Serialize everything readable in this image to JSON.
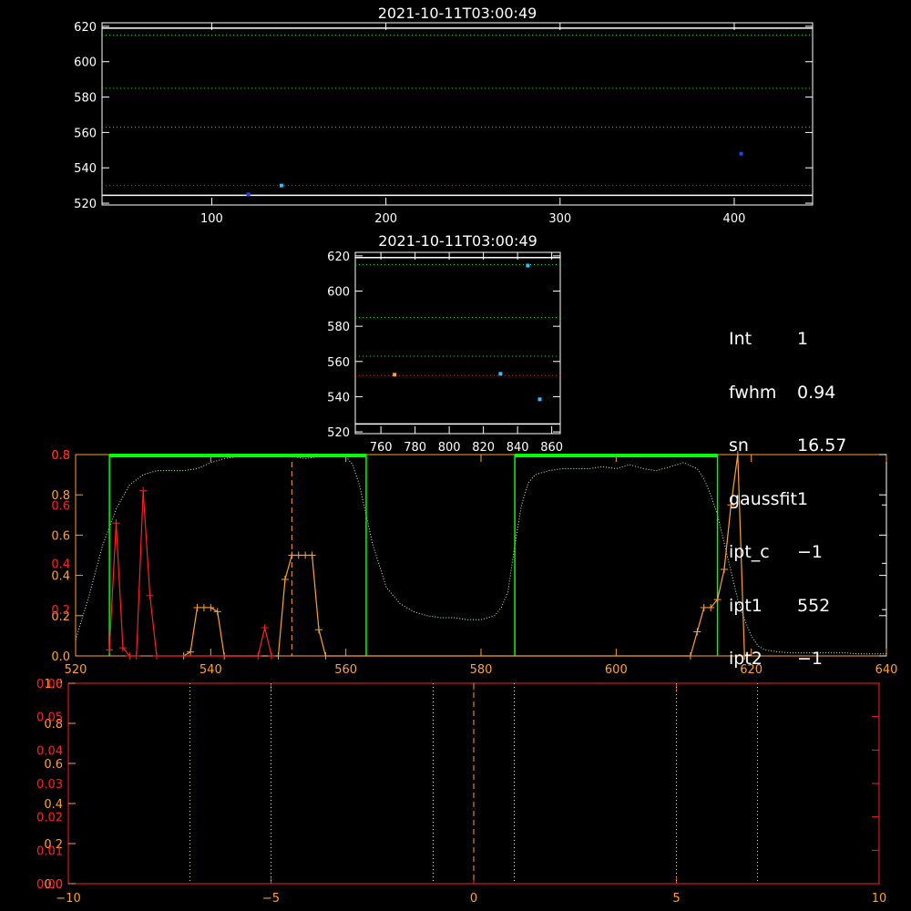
{
  "colors": {
    "background": "#000000",
    "axis": "#ffffff",
    "axis_red": "#ff2020",
    "accent_orange": "#ffa030",
    "green_line": "#00ff00",
    "dotted_green": "#30d030",
    "dotted_red": "#d03030",
    "dotted_yellow": "#e0e080",
    "dotted_light": "#c8ffc8",
    "red_series": "#ff2020",
    "orange_series": "#ffa030",
    "cyan_point": "#30c0ff",
    "blue_point": "#2040ff"
  },
  "info": [
    {
      "key": "Int",
      "value": "1"
    },
    {
      "key": "fwhm",
      "value": "0.94"
    },
    {
      "key": "sn",
      "value": "16.57"
    },
    {
      "key": "gaussfit",
      "value": "1"
    },
    {
      "key": "ipt_c",
      "value": "−1"
    },
    {
      "key": "ipt1",
      "value": "552"
    },
    {
      "key": "ipt2",
      "value": "−1"
    }
  ],
  "chart_data": [
    {
      "type": "scatter",
      "title": "2021-10-11T03:00:49",
      "xlim": [
        37,
        445
      ],
      "ylim": [
        519,
        622
      ],
      "xticks": [
        100,
        200,
        300,
        400
      ],
      "yticks": [
        520,
        540,
        560,
        580,
        600,
        620
      ],
      "hlines_green": [
        615,
        585,
        563
      ],
      "hlines_red": [
        530
      ],
      "hlines_white": [
        619,
        524.5
      ],
      "points": [
        {
          "x": 140,
          "y": 530,
          "color": "cyan"
        },
        {
          "x": 404,
          "y": 548,
          "color": "blue"
        },
        {
          "x": 121,
          "y": 525,
          "color": "blue"
        }
      ]
    },
    {
      "type": "scatter",
      "title": "2021-10-11T03:00:49",
      "xlim": [
        745,
        865
      ],
      "ylim": [
        519,
        622
      ],
      "xticks": [
        760,
        780,
        800,
        820,
        840,
        860
      ],
      "yticks": [
        520,
        540,
        560,
        580,
        600,
        620
      ],
      "hlines_green": [
        615,
        585,
        563
      ],
      "hlines_red": [
        552
      ],
      "hlines_white": [
        619,
        524.5
      ],
      "points": [
        {
          "x": 846,
          "y": 614.5,
          "color": "cyan"
        },
        {
          "x": 830,
          "y": 553,
          "color": "cyan"
        },
        {
          "x": 768,
          "y": 552.5,
          "color": "orange"
        },
        {
          "x": 853,
          "y": 538.5,
          "color": "cyan"
        }
      ]
    },
    {
      "type": "line",
      "xlim": [
        520,
        640
      ],
      "ylim": [
        0,
        1
      ],
      "xticks": [
        520,
        540,
        560,
        580,
        600,
        620,
        640
      ],
      "yticks_orange": [
        0.0,
        0.2,
        0.4,
        0.6,
        0.8
      ],
      "yticks_red": [
        0.2,
        0.4,
        0.6,
        0.8
      ],
      "ytick_labels_orange": [
        "0.0",
        "0.2",
        "0.4",
        "0.6",
        "0.8",
        "0.8"
      ],
      "ytick_labels_red": [
        "0.2",
        "0.4",
        "0.6",
        "0.8"
      ],
      "green_boxes": [
        [
          525,
          563
        ],
        [
          585,
          615
        ]
      ],
      "vline_dashed": 552,
      "red_series": {
        "x": [
          525,
          526,
          527,
          528,
          529,
          530,
          531,
          532,
          547,
          548,
          549
        ],
        "y": [
          0.03,
          0.66,
          0.04,
          0.0,
          0.0,
          0.82,
          0.3,
          0.0,
          0.0,
          0.14,
          0.0
        ]
      },
      "orange_series": {
        "x": [
          536,
          537,
          538,
          539,
          540,
          541,
          542,
          550,
          551,
          552,
          553,
          554,
          555,
          556,
          557,
          611,
          612,
          613,
          614,
          615,
          616,
          617,
          618,
          619
        ],
        "y": [
          0.0,
          0.02,
          0.24,
          0.24,
          0.24,
          0.22,
          0.0,
          0.0,
          0.38,
          0.5,
          0.5,
          0.5,
          0.5,
          0.13,
          0.0,
          0.0,
          0.12,
          0.24,
          0.24,
          0.28,
          0.43,
          0.75,
          1.0,
          0.0
        ]
      },
      "dotted_profile": {
        "x": [
          520,
          522,
          524,
          526,
          528,
          530,
          532,
          534,
          536,
          538,
          540,
          542,
          544,
          546,
          548,
          550,
          552,
          554,
          556,
          558,
          560,
          561,
          562,
          563,
          564,
          566,
          568,
          570,
          572,
          574,
          576,
          578,
          580,
          582,
          583,
          584,
          585,
          586,
          587,
          588,
          590,
          592,
          594,
          596,
          598,
          600,
          602,
          604,
          606,
          608,
          610,
          612,
          613,
          614,
          615,
          616,
          617,
          618,
          619,
          620,
          621,
          622,
          624,
          626,
          628,
          630,
          632,
          634,
          636,
          638,
          640
        ],
        "y": [
          0.08,
          0.3,
          0.55,
          0.73,
          0.85,
          0.9,
          0.92,
          0.92,
          0.92,
          0.93,
          0.96,
          0.98,
          0.99,
          1.0,
          1.0,
          1.0,
          0.99,
          0.98,
          0.99,
          1.0,
          0.99,
          0.95,
          0.85,
          0.7,
          0.55,
          0.34,
          0.26,
          0.22,
          0.2,
          0.19,
          0.19,
          0.18,
          0.18,
          0.2,
          0.24,
          0.32,
          0.55,
          0.75,
          0.86,
          0.9,
          0.92,
          0.93,
          0.93,
          0.93,
          0.94,
          0.93,
          0.95,
          0.93,
          0.92,
          0.94,
          0.96,
          0.93,
          0.88,
          0.8,
          0.7,
          0.56,
          0.42,
          0.28,
          0.18,
          0.1,
          0.05,
          0.03,
          0.02,
          0.015,
          0.015,
          0.015,
          0.015,
          0.015,
          0.01,
          0.01,
          0.01
        ]
      }
    },
    {
      "type": "line",
      "xlim": [
        -10,
        10
      ],
      "xticks": [
        -10,
        -5,
        0,
        5,
        10
      ],
      "xtick_labels": [
        "−10",
        "−5",
        "0",
        "5",
        "10"
      ],
      "yticks_orange": [
        0.0,
        0.2,
        0.4,
        0.6,
        0.8,
        1.0
      ],
      "ytick_labels_orange": [
        "0.0",
        "0.2",
        "0.4",
        "0.6",
        "0.8",
        "1.0"
      ],
      "ytick_labels_red": [
        "0.00",
        "0.01",
        "0.02",
        "0.03",
        "0.04",
        "0.05",
        "0.06"
      ],
      "vlines_dotted_yellow": [
        -7,
        -5,
        5,
        7
      ],
      "vlines_dotted_white": [
        -1,
        1
      ],
      "vline_dashed_orange": 0
    }
  ]
}
